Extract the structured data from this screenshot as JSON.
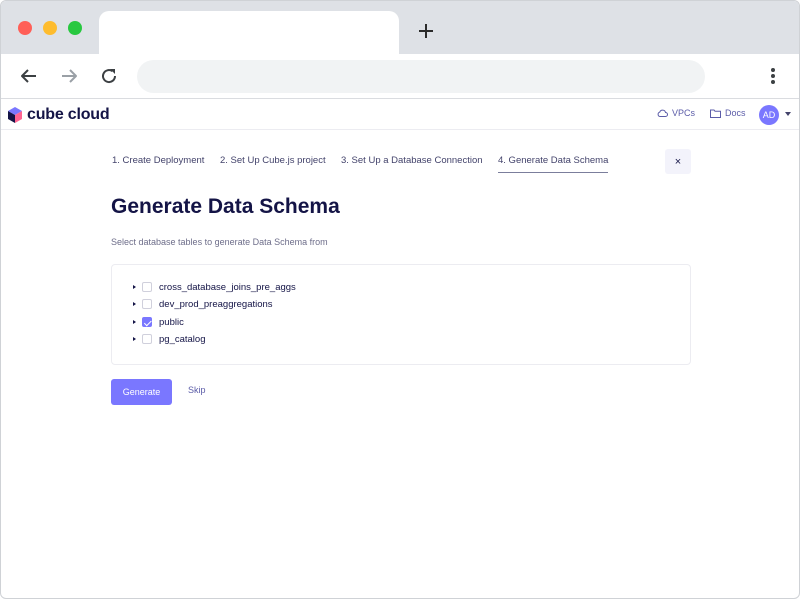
{
  "browser": {
    "new_tab_symbol": "+",
    "icons": [
      "back-arrow-icon",
      "forward-arrow-icon",
      "reload-icon",
      "kebab-menu-icon"
    ]
  },
  "header": {
    "logo_text": "cube cloud",
    "vpcs_label": "VPCs",
    "docs_label": "Docs",
    "avatar_initials": "AD"
  },
  "wizard": {
    "steps": [
      {
        "label": "1. Create Deployment"
      },
      {
        "label": "2. Set Up Cube.js project"
      },
      {
        "label": "3. Set Up a Database Connection"
      },
      {
        "label": "4. Generate Data Schema",
        "active": true
      }
    ],
    "close_symbol": "×",
    "title": "Generate Data Schema",
    "subtitle": "Select database tables to generate Data Schema from",
    "schemas": [
      {
        "label": "cross_database_joins_pre_aggs",
        "checked": false
      },
      {
        "label": "dev_prod_preaggregations",
        "checked": false
      },
      {
        "label": "public",
        "checked": true
      },
      {
        "label": "pg_catalog",
        "checked": false
      }
    ],
    "generate_label": "Generate",
    "skip_label": "Skip"
  },
  "colors": {
    "accent": "#7a77ff",
    "text_dark": "#141446",
    "link": "#5b5ca8"
  }
}
